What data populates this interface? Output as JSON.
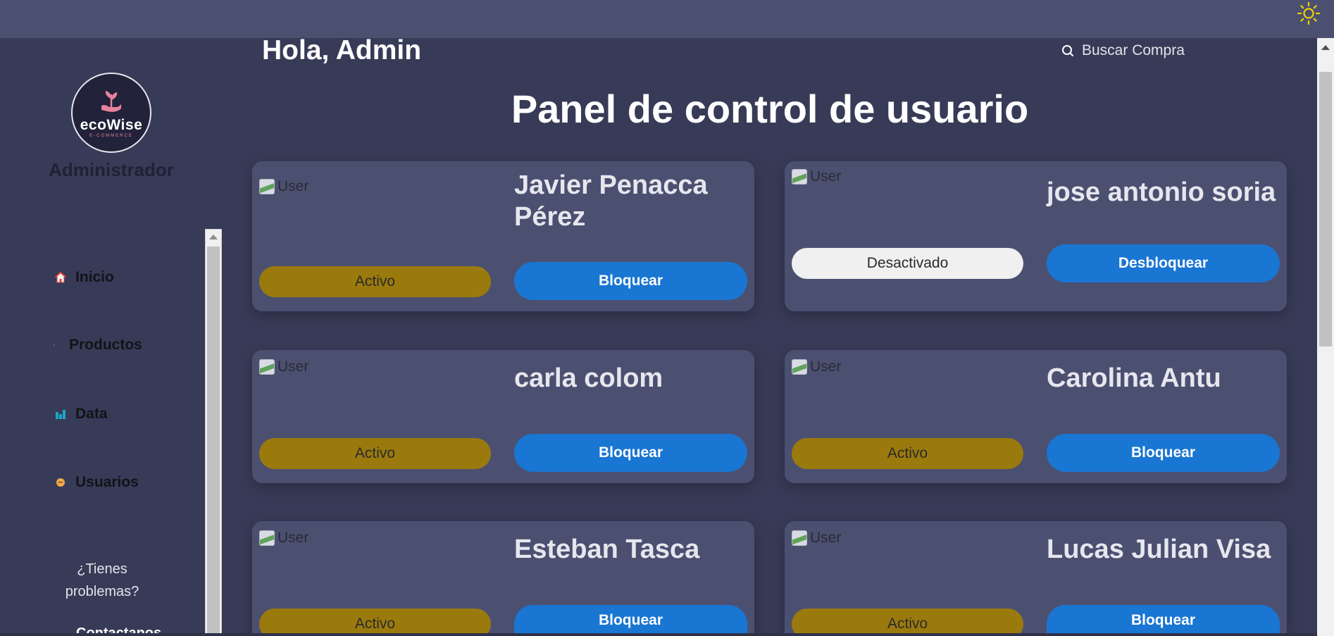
{
  "header": {
    "theme_icon": "sun-icon"
  },
  "sidebar": {
    "logo": {
      "text": "ecoWise",
      "subtext": "E-COMMERCE"
    },
    "role": "Administrador",
    "items": [
      {
        "label": "Inicio",
        "icon": "home-icon"
      },
      {
        "label": "Productos",
        "icon": "products-icon"
      },
      {
        "label": "Data",
        "icon": "bar-chart-icon"
      },
      {
        "label": "Usuarios",
        "icon": "user-face-icon"
      }
    ],
    "help": "¿Tienes problemas?",
    "contact": "Contactanos"
  },
  "main": {
    "greeting": "Hola, Admin",
    "search": {
      "placeholder": "Buscar Compra",
      "icon": "search-icon"
    },
    "title": "Panel de control de usuario",
    "users": [
      {
        "avatar_alt": "User",
        "name": "Javier Penacca Pérez",
        "status": "Activo",
        "action": "Bloquear"
      },
      {
        "avatar_alt": "User",
        "name": "jose antonio soria",
        "status": "Desactivado",
        "action": "Desbloquear"
      },
      {
        "avatar_alt": "User",
        "name": "carla colom",
        "status": "Activo",
        "action": "Bloquear"
      },
      {
        "avatar_alt": "User",
        "name": "Carolina Antu",
        "status": "Activo",
        "action": "Bloquear"
      },
      {
        "avatar_alt": "User",
        "name": "Esteban Tasca",
        "status": "Activo",
        "action": "Bloquear"
      },
      {
        "avatar_alt": "User",
        "name": "Lucas Julian Visa",
        "status": "Activo",
        "action": "Bloquear"
      }
    ]
  },
  "colors": {
    "background": "#373b57",
    "topbar": "#4b5071",
    "card": "#4b5071",
    "status_active": "#9b7a0d",
    "status_inactive": "#f0f0f0",
    "action_button": "#1976d2",
    "sun": "#f2d000"
  }
}
